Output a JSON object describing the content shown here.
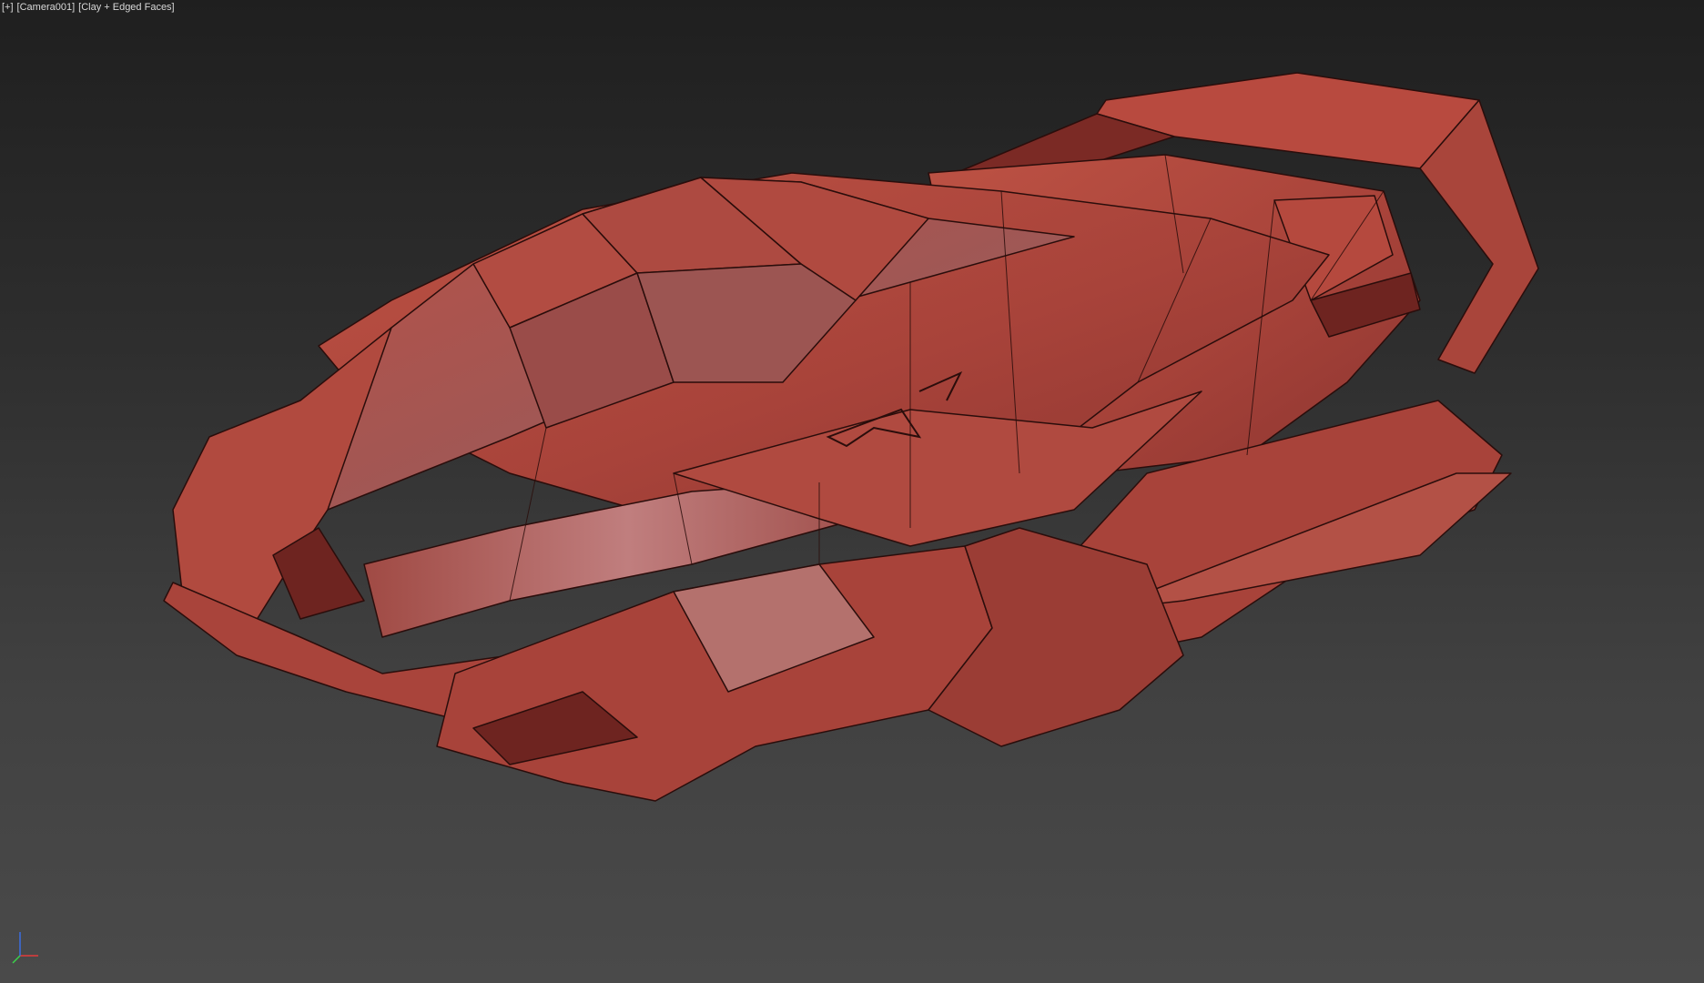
{
  "viewport": {
    "menu_label": "[+]",
    "camera_label": "[Camera001]",
    "shading_label": "[Clay + Edged Faces]"
  },
  "scene": {
    "object": "spaceship-model",
    "material_color": "#b5493e",
    "shadow_color": "#6e2420",
    "highlight_color": "#c97870",
    "edge_color": "#2a0d0b"
  },
  "gizmo": {
    "axes": [
      {
        "name": "x",
        "color": "#e23a3a"
      },
      {
        "name": "y",
        "color": "#3ad24a"
      },
      {
        "name": "z",
        "color": "#3a6de2"
      }
    ]
  }
}
